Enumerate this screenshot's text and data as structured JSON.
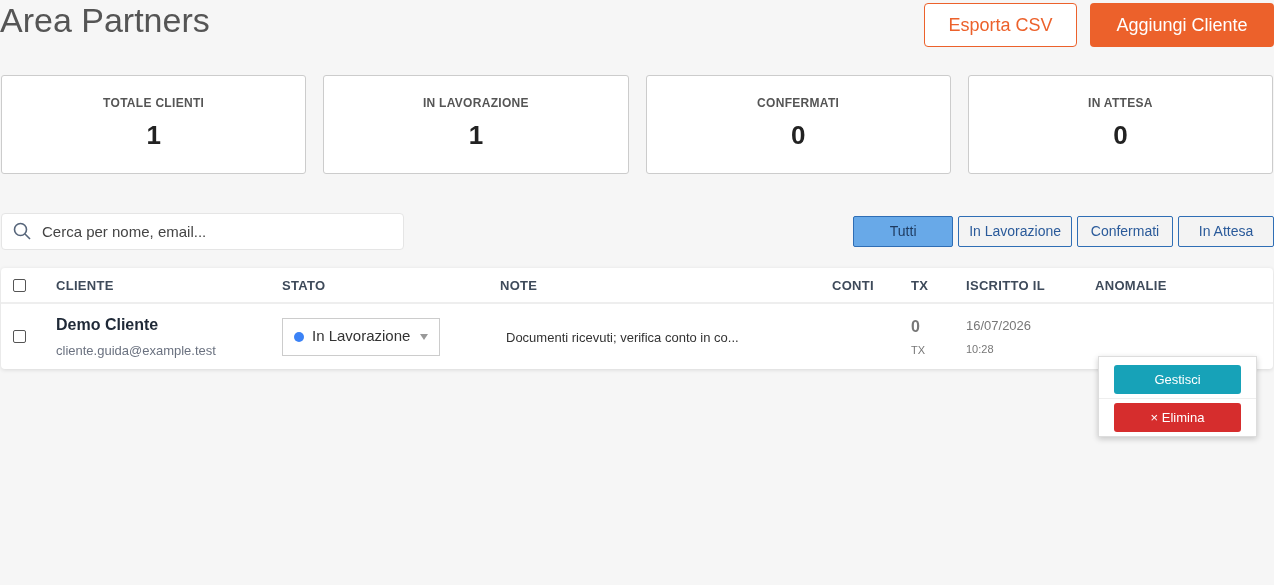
{
  "title": "Area Partners",
  "actions": [
    {
      "label": "Esporta CSV",
      "kind": "outline"
    },
    {
      "label": "Aggiungi Cliente",
      "kind": "primary"
    }
  ],
  "stats": [
    {
      "label": "TOTALE CLIENTI",
      "value": "1"
    },
    {
      "label": "IN LAVORAZIONE",
      "value": "1"
    },
    {
      "label": "CONFERMATI",
      "value": "0"
    },
    {
      "label": "IN ATTESA",
      "value": "0"
    }
  ],
  "search": {
    "placeholder": "Cerca per nome, email..."
  },
  "filters": [
    {
      "label": "Tutti",
      "selected": true
    },
    {
      "label": "In Lavorazione",
      "selected": false
    },
    {
      "label": "Confermati",
      "selected": false
    },
    {
      "label": "In Attesa",
      "selected": false
    }
  ],
  "table": {
    "select_all": {
      "checked": false
    },
    "columns": [
      "CLIENTE",
      "STATO",
      "NOTE",
      "CONTI",
      "TX",
      "ISCRITTO IL",
      "ANOMALIE"
    ],
    "rows": [
      {
        "checked": false,
        "name": "Demo Cliente",
        "email": "cliente.guida@example.test",
        "status": {
          "label": "In Lavorazione",
          "color": "#3b82f6"
        },
        "note": "Documenti ricevuti; verifica conto in co...",
        "tx": "0",
        "tx_unit": "TX",
        "date": "16/07/2026",
        "time": "10:28"
      }
    ]
  },
  "row_menu": [
    {
      "label": "Gestisci",
      "kind": "manage"
    },
    {
      "label": "× Elimina",
      "kind": "delete"
    }
  ]
}
